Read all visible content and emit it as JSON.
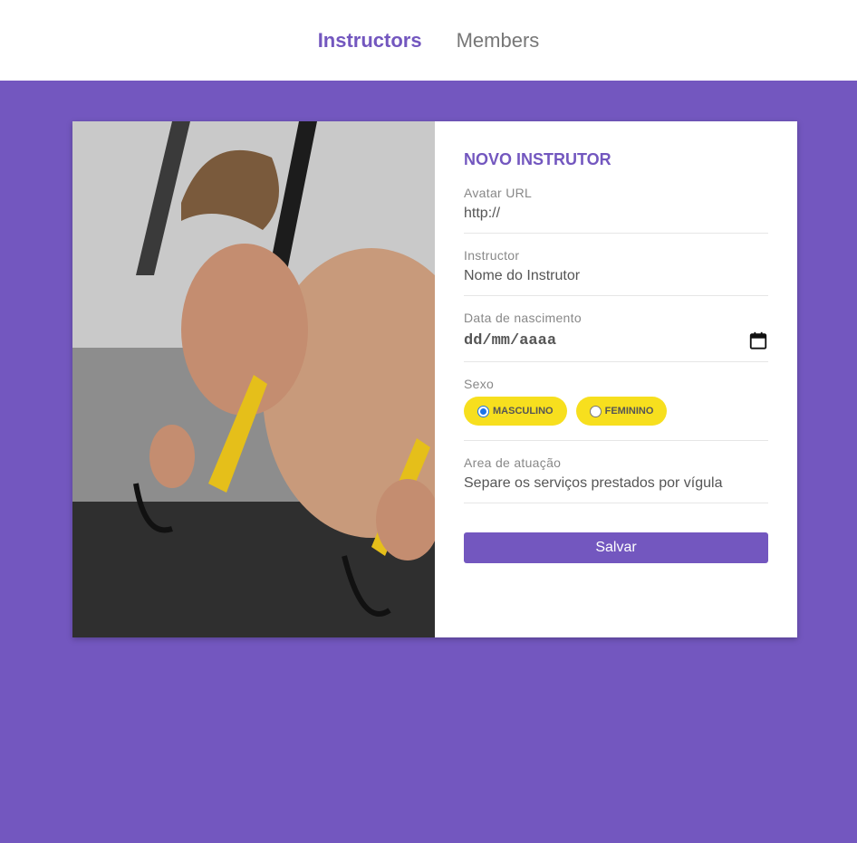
{
  "nav": {
    "instructors": "Instructors",
    "members": "Members"
  },
  "form": {
    "title": "Novo Instrutor",
    "avatar": {
      "label": "Avatar URL",
      "placeholder": "http://"
    },
    "name": {
      "label": "Instructor",
      "placeholder": "Nome do Instrutor"
    },
    "birth": {
      "label": "Data de nascimento",
      "placeholder": "dd/mm/aaaa"
    },
    "gender": {
      "label": "Sexo",
      "options": [
        {
          "label": "Masculino",
          "checked": true
        },
        {
          "label": "Feminino",
          "checked": false
        }
      ]
    },
    "services": {
      "label": "Area de atuação",
      "placeholder": "Separe os serviços prestados por vígula"
    },
    "submit": "Salvar"
  },
  "colors": {
    "primary": "#7357bf",
    "pill": "#f7df1e",
    "radio_checked": "#1a73e8"
  },
  "icons": {
    "calendar": "calendar-icon"
  }
}
